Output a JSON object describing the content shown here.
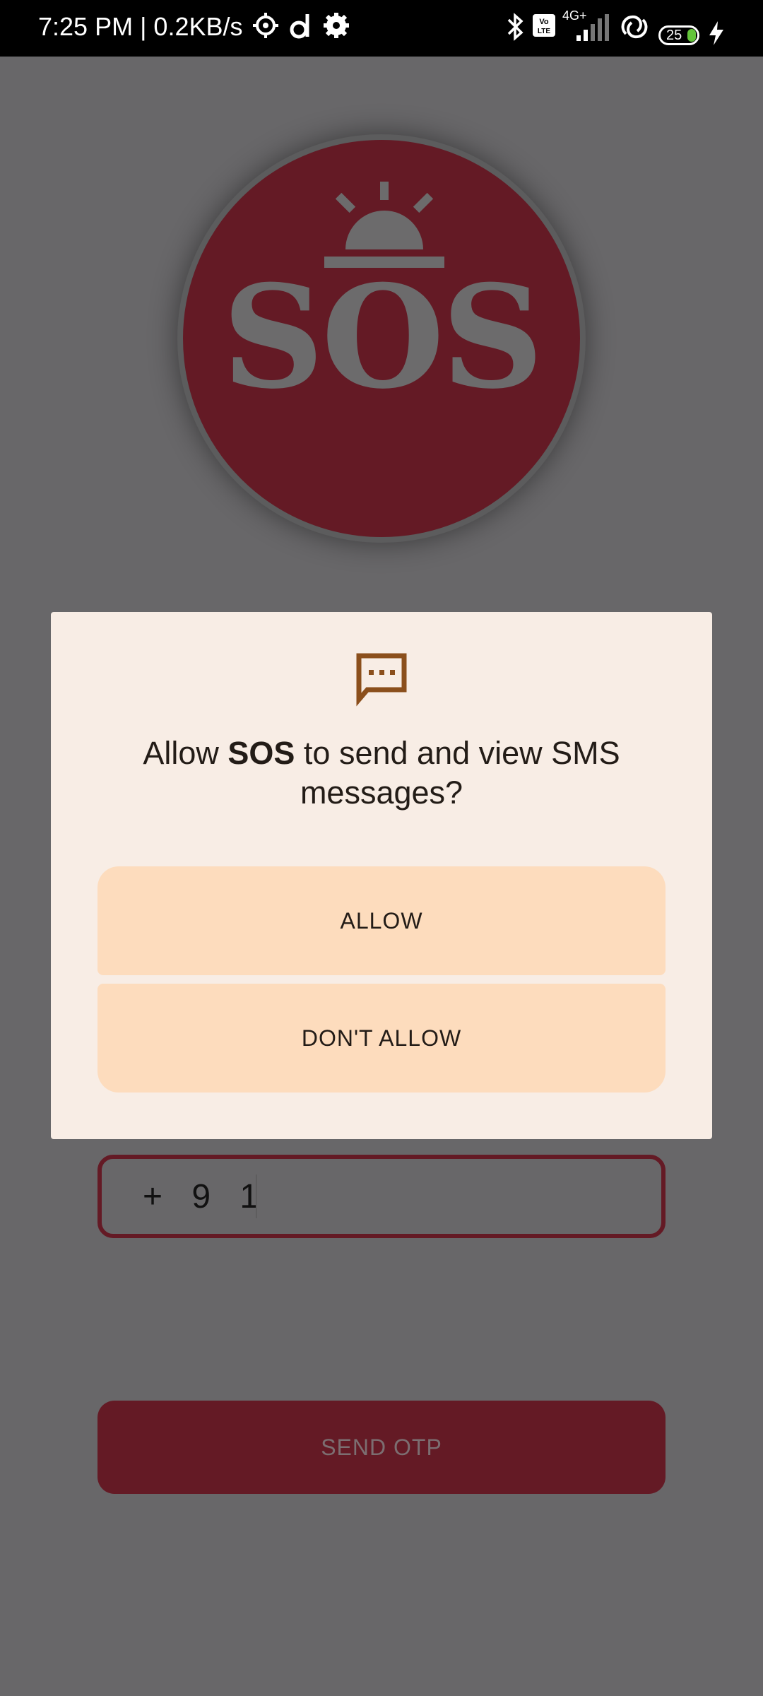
{
  "status_bar": {
    "time": "7:25 PM | 0.2KB/s",
    "battery": "25",
    "network": "4G+"
  },
  "logo": {
    "text": "SOS"
  },
  "phone": {
    "country_code": "+ 9 1"
  },
  "send_otp": {
    "label": "SEND OTP"
  },
  "dialog": {
    "title_prefix": "Allow ",
    "app_name": "SOS",
    "title_suffix": " to send and view SMS messages?",
    "allow_label": "ALLOW",
    "deny_label": "DON'T ALLOW"
  },
  "colors": {
    "scrim_background": "#686769",
    "brand_red": "#641a25",
    "dialog_bg": "#f8ede5",
    "dialog_button_bg": "#fddcbd",
    "dialog_icon": "#8b4f1c"
  }
}
